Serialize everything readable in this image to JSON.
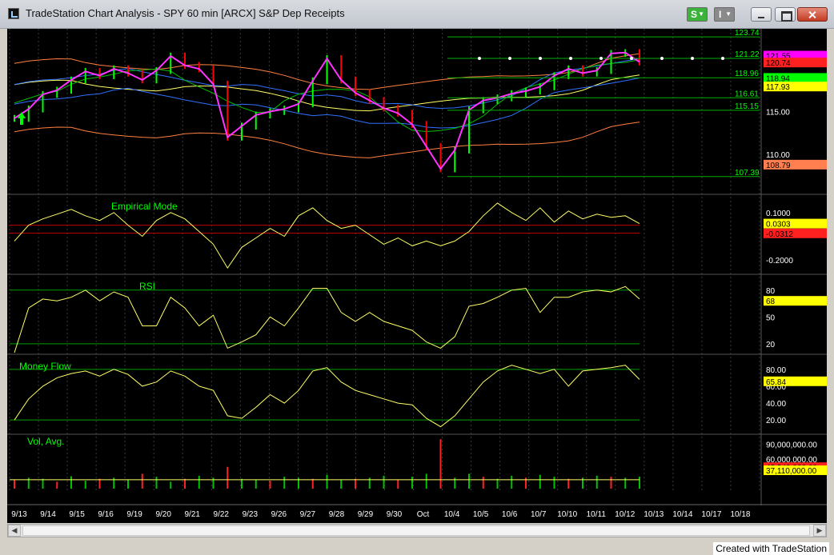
{
  "window": {
    "title": "TradeStation Chart Analysis - SPY 60 min [ARCX] S&P Dep Receipts",
    "s_button_label": "S",
    "i_button_label": "I",
    "footer": "Created with TradeStation"
  },
  "colors": {
    "background": "#000000",
    "price_bar_up": "#00ff00",
    "price_bar_down": "#ff0000",
    "highlight_line": "#ff33ff",
    "green_line": "#00c000",
    "yellow_line": "#ffff66",
    "blue_line": "#3070ff",
    "orange_line": "#ff8040",
    "axis_text": "#ffffff"
  },
  "chart_data": [
    {
      "type": "line",
      "name": "price",
      "title": "",
      "x_labels": [
        "9/13",
        "9/14",
        "9/15",
        "9/16",
        "9/19",
        "9/20",
        "9/21",
        "9/22",
        "9/23",
        "9/26",
        "9/27",
        "9/28",
        "9/29",
        "9/30",
        "Oct",
        "10/4",
        "10/5",
        "10/6",
        "10/7",
        "10/10",
        "10/11",
        "10/12",
        "10/13",
        "10/14",
        "10/17",
        "10/18"
      ],
      "y_ticks": [
        "115.00",
        "110.00"
      ],
      "ylim": [
        105.5,
        124.5
      ],
      "closes": [
        114.2,
        115.3,
        117.0,
        117.5,
        118.7,
        119.7,
        119.2,
        120.0,
        119.5,
        118.7,
        119.8,
        121.5,
        120.4,
        120.0,
        118.2,
        112.0,
        113.3,
        114.6,
        115.0,
        115.3,
        115.9,
        118.6,
        121.2,
        118.7,
        117.2,
        116.3,
        115.4,
        114.8,
        113.5,
        110.9,
        108.3,
        110.5,
        115.2,
        116.3,
        116.6,
        117.1,
        117.4,
        117.9,
        119.2,
        120.0,
        119.5,
        119.8,
        121.8,
        121.9,
        120.8
      ],
      "reference_lines": [
        {
          "label": "123.74",
          "value": 123.74
        },
        {
          "label": "121.22",
          "value": 121.22
        },
        {
          "label": "118.96",
          "value": 118.96
        },
        {
          "label": "116.61",
          "value": 116.61
        },
        {
          "label": "115.15",
          "value": 115.15
        },
        {
          "label": "107.39",
          "value": 107.39
        }
      ],
      "price_tags": [
        {
          "label": "121.55",
          "value": 121.55,
          "color": "#ff00ff"
        },
        {
          "label": "120.74",
          "value": 120.74,
          "color": "#ff2020"
        },
        {
          "label": "118.94",
          "value": 118.94,
          "color": "#00ff00"
        },
        {
          "label": "117.93",
          "value": 117.93,
          "color": "#ffff00"
        },
        {
          "label": "108.79",
          "value": 108.79,
          "color": "#ff7f50"
        }
      ]
    },
    {
      "type": "line",
      "name": "Empirical Mode",
      "title": "Empirical Mode",
      "y_ticks": [
        "0.1000",
        "-0.2000"
      ],
      "ylim": [
        -0.28,
        0.2
      ],
      "values": [
        -0.08,
        0.02,
        0.06,
        0.09,
        0.12,
        0.08,
        0.05,
        0.1,
        0.02,
        -0.05,
        0.05,
        0.1,
        0.06,
        -0.02,
        -0.1,
        -0.25,
        -0.12,
        -0.06,
        0.0,
        -0.05,
        0.08,
        0.13,
        0.05,
        0.0,
        0.02,
        -0.04,
        -0.1,
        -0.06,
        -0.11,
        -0.08,
        -0.11,
        -0.08,
        -0.02,
        0.08,
        0.16,
        0.1,
        0.05,
        0.13,
        0.04,
        0.11,
        0.06,
        0.09,
        0.07,
        0.08,
        0.03
      ],
      "price_tags": [
        {
          "label": "0.0303",
          "value": 0.0303,
          "color": "#ffff00"
        },
        {
          "label": "-0.0312",
          "value": -0.0312,
          "color": "#ff2020"
        }
      ]
    },
    {
      "type": "line",
      "name": "RSI",
      "title": "RSI",
      "y_ticks": [
        "80",
        "50",
        "20"
      ],
      "ylim": [
        10,
        95
      ],
      "values": [
        10,
        60,
        70,
        68,
        72,
        80,
        68,
        78,
        72,
        40,
        40,
        72,
        60,
        40,
        52,
        15,
        22,
        30,
        50,
        40,
        60,
        82,
        82,
        55,
        45,
        55,
        45,
        40,
        35,
        22,
        15,
        28,
        62,
        65,
        72,
        80,
        82,
        55,
        72,
        72,
        78,
        80,
        78,
        84,
        70
      ],
      "price_tags": [
        {
          "label": "68",
          "value": 68,
          "color": "#ffff00"
        }
      ]
    },
    {
      "type": "line",
      "name": "Money Flow",
      "title": "Money Flow",
      "y_ticks": [
        "80.00",
        "60.00",
        "40.00",
        "20.00"
      ],
      "ylim": [
        5,
        95
      ],
      "values": [
        20,
        45,
        60,
        70,
        75,
        78,
        72,
        80,
        74,
        60,
        65,
        78,
        72,
        60,
        55,
        25,
        22,
        35,
        50,
        40,
        55,
        78,
        82,
        65,
        55,
        50,
        45,
        40,
        38,
        22,
        12,
        25,
        45,
        65,
        78,
        85,
        80,
        75,
        80,
        60,
        78,
        80,
        82,
        85,
        68
      ],
      "price_tags": [
        {
          "label": "65.84",
          "value": 65.84,
          "color": "#ffff00"
        }
      ]
    },
    {
      "type": "bar",
      "name": "Vol, Avg.",
      "title": "Vol, Avg.",
      "y_ticks": [
        "90,000,000.00",
        "60,000,000.00"
      ],
      "ylim": [
        0,
        105000000
      ],
      "values": [
        18,
        22,
        20,
        14,
        25,
        16,
        20,
        22,
        18,
        30,
        24,
        14,
        20,
        26,
        22,
        44,
        20,
        18,
        16,
        24,
        22,
        20,
        28,
        18,
        20,
        22,
        26,
        18,
        24,
        30,
        100,
        22,
        30,
        24,
        20,
        26,
        22,
        28,
        24,
        20,
        22,
        26,
        24,
        22,
        24
      ],
      "value_scale": 1000000,
      "average": 18000000,
      "price_tags": [
        {
          "label": "43,249,960.00",
          "value": 43249960,
          "color": "#ff2020"
        },
        {
          "label": "37,110,000.00",
          "value": 37110000,
          "color": "#ffff00"
        }
      ]
    }
  ]
}
